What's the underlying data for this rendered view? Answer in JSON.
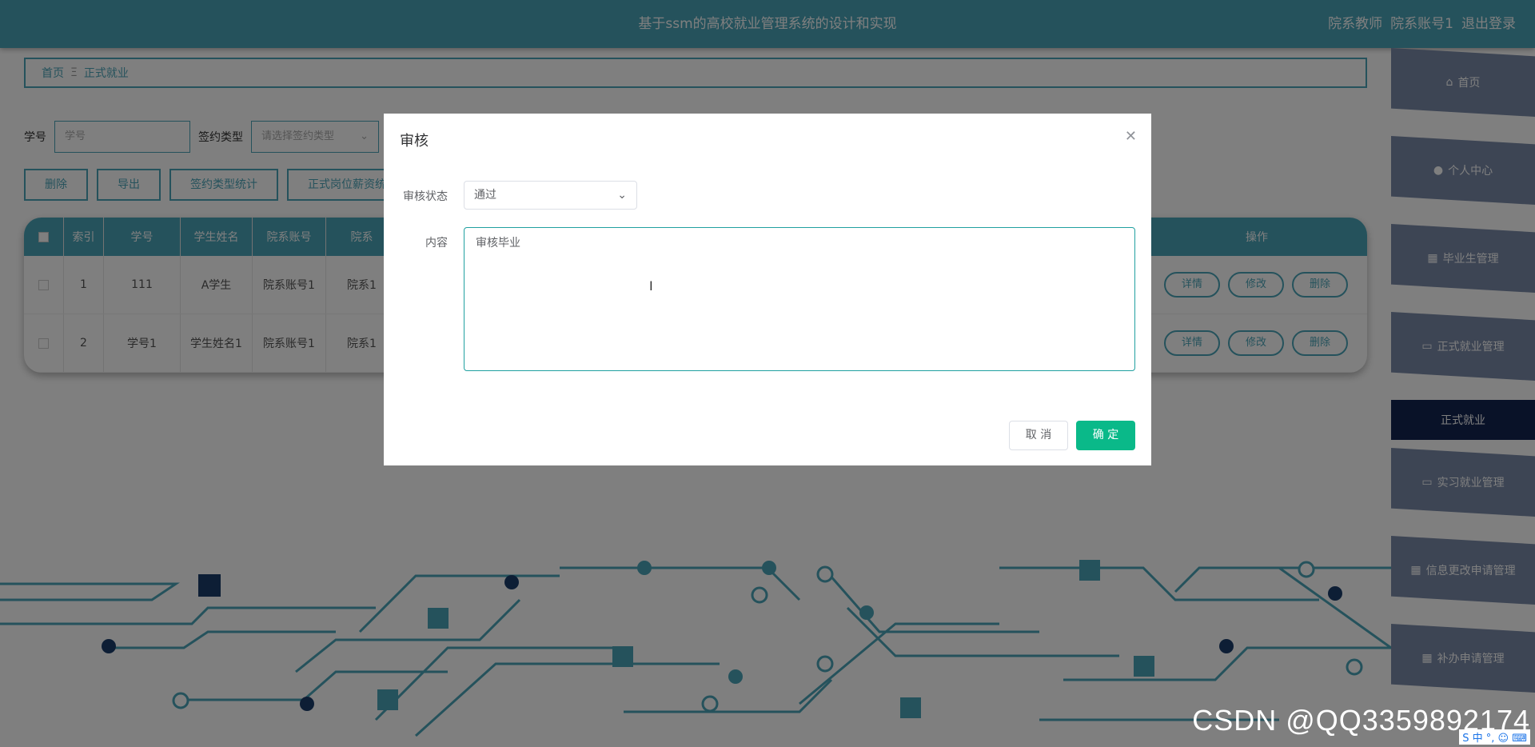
{
  "header": {
    "title": "基于ssm的高校就业管理系统的设计和实现",
    "role": "院系教师",
    "account": "院系账号1",
    "logout": "退出登录"
  },
  "breadcrumb": {
    "home": "首页",
    "separator": "Ξ",
    "current": "正式就业"
  },
  "search": {
    "id_label": "学号",
    "id_placeholder": "学号",
    "type_label": "签约类型",
    "type_placeholder": "请选择签约类型"
  },
  "actions": {
    "delete": "删除",
    "export": "导出",
    "stat": "签约类型统计",
    "salary": "正式岗位薪资统"
  },
  "table": {
    "headers": [
      "",
      "索引",
      "学号",
      "学生姓名",
      "院系账号",
      "院系",
      "操作"
    ],
    "rows": [
      {
        "index": "1",
        "id": "111",
        "name": "A学生",
        "dept_account": "院系账号1",
        "dept": "院系1"
      },
      {
        "index": "2",
        "id": "学号1",
        "name": "学生姓名1",
        "dept_account": "院系账号1",
        "dept": "院系1"
      }
    ],
    "ops": {
      "detail": "详情",
      "edit": "修改",
      "delete": "删除"
    }
  },
  "sidebar": {
    "items": [
      {
        "label": "首页",
        "icon": "home-icon"
      },
      {
        "label": "个人中心",
        "icon": "user-icon"
      },
      {
        "label": "毕业生管理",
        "icon": "grid-icon"
      },
      {
        "label": "正式就业管理",
        "icon": "monitor-icon"
      },
      {
        "label": "正式就业",
        "icon": ""
      },
      {
        "label": "实习就业管理",
        "icon": "monitor-icon"
      },
      {
        "label": "信息更改申请管理",
        "icon": "grid-icon"
      },
      {
        "label": "补办申请管理",
        "icon": "grid-icon"
      }
    ],
    "active_index": 4
  },
  "dialog": {
    "title": "审核",
    "status_label": "审核状态",
    "status_value": "通过",
    "content_label": "内容",
    "content_value": "审核毕业",
    "cancel": "取 消",
    "confirm": "确 定"
  },
  "watermark": "CSDN @QQ3359892174",
  "ime": "S 中 °, ☺ ⌨",
  "colors": {
    "primary": "#4aa5b8",
    "confirm": "#0ab989",
    "sidebar_active": "#122450"
  }
}
